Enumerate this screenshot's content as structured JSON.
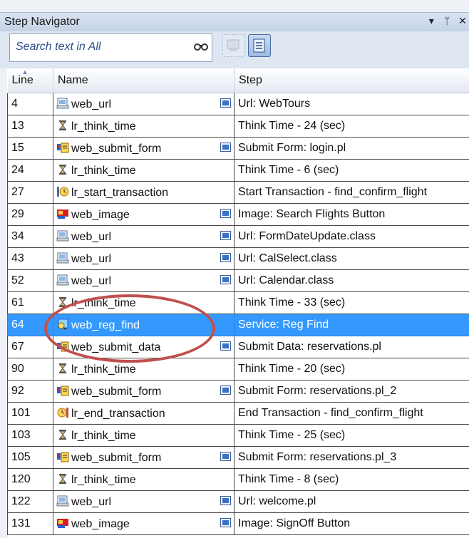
{
  "window": {
    "title": "Step Navigator",
    "controls": [
      "▾",
      "ᛘ",
      "✕"
    ]
  },
  "search": {
    "placeholder": "Search text in All"
  },
  "columns": {
    "line": "Line",
    "name": "Name",
    "step": "Step"
  },
  "rows": [
    {
      "line": "4",
      "icon": "url-icon",
      "name": "web_url",
      "mini": true,
      "step": "Url: WebTours"
    },
    {
      "line": "13",
      "icon": "hourglass-icon",
      "name": "lr_think_time",
      "mini": false,
      "step": "Think Time - 24 (sec)"
    },
    {
      "line": "15",
      "icon": "submit-form-icon",
      "name": "web_submit_form",
      "mini": true,
      "step": "Submit Form: login.pl"
    },
    {
      "line": "24",
      "icon": "hourglass-icon",
      "name": "lr_think_time",
      "mini": false,
      "step": "Think Time - 6 (sec)"
    },
    {
      "line": "27",
      "icon": "start-transaction-icon",
      "name": "lr_start_transaction",
      "mini": false,
      "step": "Start Transaction - find_confirm_flight"
    },
    {
      "line": "29",
      "icon": "image-icon",
      "name": "web_image",
      "mini": true,
      "step": "Image: Search Flights Button"
    },
    {
      "line": "34",
      "icon": "url-icon",
      "name": "web_url",
      "mini": true,
      "step": "Url: FormDateUpdate.class"
    },
    {
      "line": "43",
      "icon": "url-icon",
      "name": "web_url",
      "mini": true,
      "step": "Url: CalSelect.class"
    },
    {
      "line": "52",
      "icon": "url-icon",
      "name": "web_url",
      "mini": true,
      "step": "Url: Calendar.class"
    },
    {
      "line": "61",
      "icon": "hourglass-icon",
      "name": "lr_think_time",
      "mini": false,
      "step": "Think Time - 33 (sec)"
    },
    {
      "line": "64",
      "icon": "reg-find-icon",
      "name": "web_reg_find",
      "mini": false,
      "step": "Service: Reg Find",
      "selected": true
    },
    {
      "line": "67",
      "icon": "submit-data-icon",
      "name": "web_submit_data",
      "mini": true,
      "step": "Submit Data: reservations.pl"
    },
    {
      "line": "90",
      "icon": "hourglass-icon",
      "name": "lr_think_time",
      "mini": false,
      "step": "Think Time - 20 (sec)"
    },
    {
      "line": "92",
      "icon": "submit-form-icon",
      "name": "web_submit_form",
      "mini": true,
      "step": "Submit Form: reservations.pl_2"
    },
    {
      "line": "101",
      "icon": "end-transaction-icon",
      "name": "lr_end_transaction",
      "mini": false,
      "step": "End Transaction - find_confirm_flight"
    },
    {
      "line": "103",
      "icon": "hourglass-icon",
      "name": "lr_think_time",
      "mini": false,
      "step": "Think Time - 25 (sec)"
    },
    {
      "line": "105",
      "icon": "submit-form-icon",
      "name": "web_submit_form",
      "mini": true,
      "step": "Submit Form: reservations.pl_3"
    },
    {
      "line": "120",
      "icon": "hourglass-icon",
      "name": "lr_think_time",
      "mini": false,
      "step": "Think Time - 8 (sec)"
    },
    {
      "line": "122",
      "icon": "url-icon",
      "name": "web_url",
      "mini": true,
      "step": "Url: welcome.pl"
    },
    {
      "line": "131",
      "icon": "image-icon",
      "name": "web_image",
      "mini": true,
      "step": "Image: SignOff Button"
    }
  ]
}
